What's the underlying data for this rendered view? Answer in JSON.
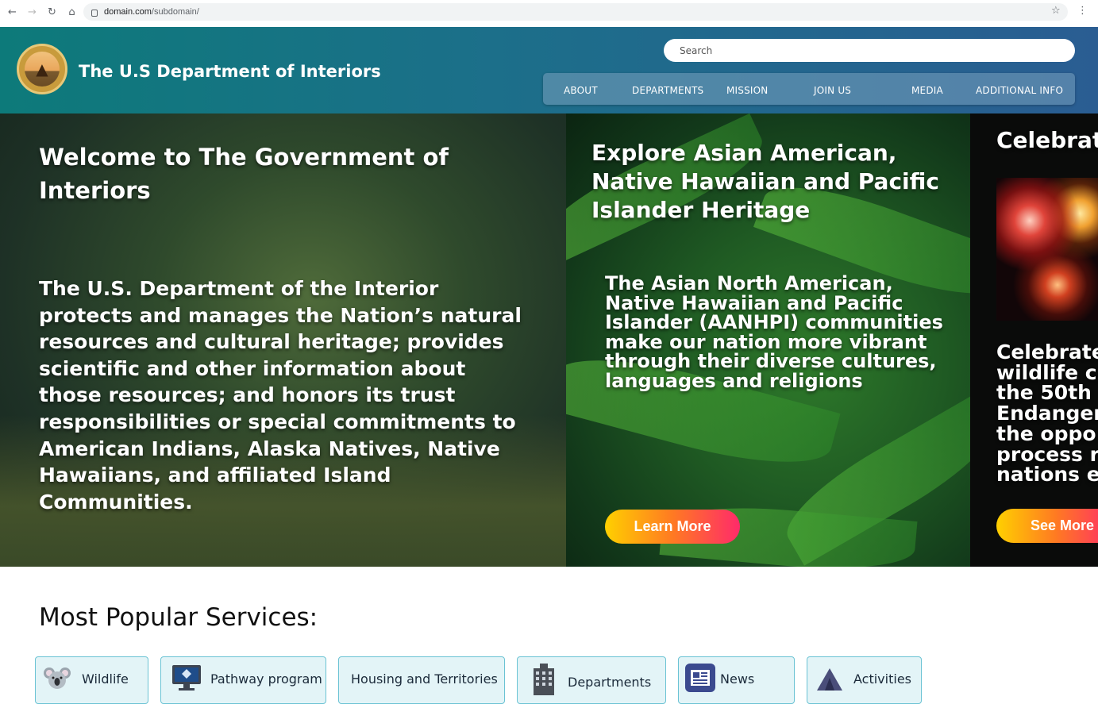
{
  "browser": {
    "url_domain": "domain.com",
    "url_path": "/subdomain/",
    "back_icon": "back-arrow-icon",
    "forward_icon": "forward-arrow-icon",
    "reload_icon": "reload-icon",
    "home_icon": "home-icon"
  },
  "header": {
    "title": "The U.S Department of Interiors",
    "search_placeholder": "Search",
    "nav": [
      "ABOUT",
      "DEPARTMENTS",
      "MISSION",
      "JOIN US",
      "MEDIA",
      "ADDITIONAL INFO"
    ],
    "gradient_start": "#0d7a7a",
    "gradient_end": "#2a5d92"
  },
  "hero": {
    "panel1": {
      "title": "Welcome to The Government of Interiors",
      "body": "The U.S. Department of the Interior protects and manages the Nation’s natural resources and cultural heritage; provides scientific and other information about those resources; and honors its trust responsibilities or special commitments to American Indians, Alaska Natives, Native Hawaiians, and affiliated Island Communities."
    },
    "panel2": {
      "title": "Explore Asian American, Native Hawaiian and Pacific Islander Heritage",
      "body": "The Asian North American, Native Hawaiian and Pacific Islander (AANHPI) communities make our nation more vibrant through their diverse cultures, languages and religions",
      "button": "Learn More"
    },
    "panel3": {
      "title": "Celebrat",
      "body_lines": [
        "Celebrate",
        "wildlife c",
        "the 50th",
        "Endanger",
        "the oppo",
        "process r",
        "nations e"
      ],
      "button": "See More"
    },
    "button_gradient": [
      "#ffd000",
      "#ff7a22",
      "#ff2a6a"
    ]
  },
  "services": {
    "heading": "Most Popular Services:",
    "items": [
      {
        "label": "Wildlife",
        "icon": "koala-icon"
      },
      {
        "label": "Pathway program",
        "icon": "computer-monitor-icon"
      },
      {
        "label": "Housing and Territories",
        "icon": ""
      },
      {
        "label": "Departments",
        "icon": "building-icon"
      },
      {
        "label": "News",
        "icon": "newspaper-icon"
      },
      {
        "label": "Activities",
        "icon": "tent-icon"
      }
    ]
  }
}
